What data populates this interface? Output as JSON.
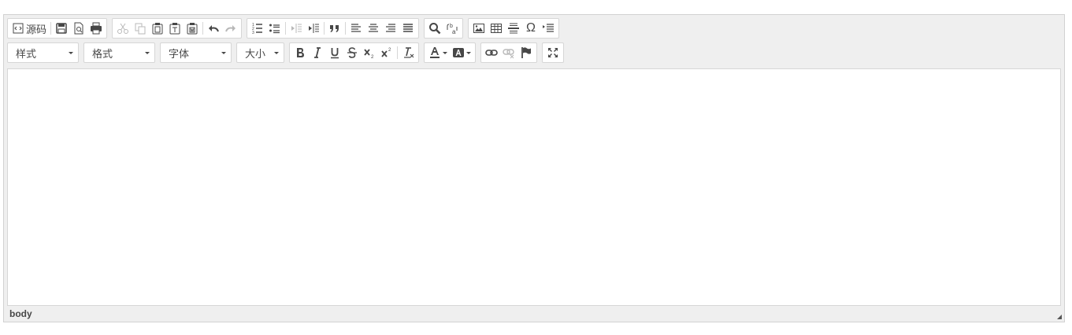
{
  "toolbar": {
    "row1": {
      "source_label": "源码"
    },
    "row2": {
      "styles_combo": "样式",
      "format_combo": "格式",
      "font_combo": "字体",
      "size_combo": "大小"
    }
  },
  "statusbar": {
    "path": "body"
  },
  "colors": {
    "toolbar_bg": "#efefef",
    "icon": "#474747",
    "disabled_icon": "#b8b8b8",
    "border": "#d1d1d1"
  }
}
